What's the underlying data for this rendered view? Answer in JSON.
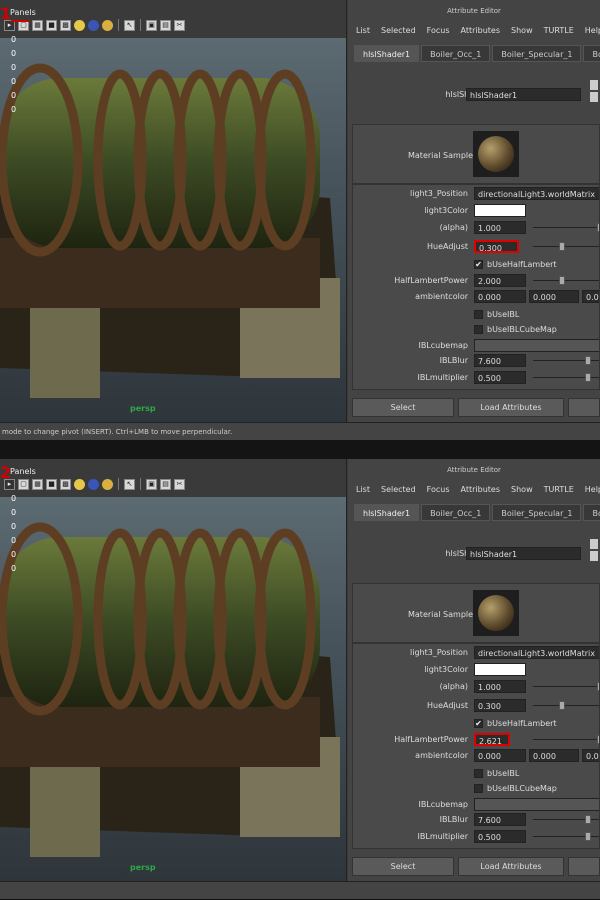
{
  "panels": [
    {
      "marker": "1",
      "viewport": {
        "menu": "Panels",
        "hud": [
          "0",
          "0",
          "0",
          "0",
          "0",
          "0"
        ],
        "camera": "persp"
      },
      "status": "mode to change pivot (INSERT).  Ctrl+LMB to move perpendicular.",
      "editor": {
        "title": "Attribute Editor",
        "menu": [
          "List",
          "Selected",
          "Focus",
          "Attributes",
          "Show",
          "TURTLE",
          "Help"
        ],
        "tabs": [
          "hlslShader1",
          "Boiler_Occ_1",
          "Boiler_Specular_1",
          "Boiler_Co"
        ],
        "shader_label": "hlslShader:",
        "shader_value": "hlslShader1",
        "material_sample": "Material Sample",
        "attrs": {
          "light3_position": {
            "label": "light3_Position",
            "value": "directionalLight3.worldMatrix"
          },
          "light3_color": {
            "label": "light3Color"
          },
          "alpha": {
            "label": "(alpha)",
            "value": "1.000"
          },
          "hue_adjust": {
            "label": "HueAdjust",
            "value": "0.300"
          },
          "b_use_half_lambert": {
            "label": "bUseHalfLambert",
            "checked": "✔"
          },
          "half_lambert_power": {
            "label": "HalfLambertPower",
            "value": "2.000"
          },
          "ambientcolor": {
            "label": "ambientcolor",
            "r": "0.000",
            "g": "0.000",
            "b": "0.000"
          },
          "b_use_ibl": {
            "label": "bUseIBL"
          },
          "b_use_ibl_cubemap": {
            "label": "bUseIBLCubeMap"
          },
          "ibl_cubemap": {
            "label": "IBLcubemap"
          },
          "ibl_blur": {
            "label": "IBLBlur",
            "value": "7.600"
          },
          "ibl_multiplier": {
            "label": "IBLmultiplier",
            "value": "0.500"
          }
        },
        "buttons": {
          "select": "Select",
          "load": "Load Attributes",
          "extra": ""
        }
      }
    },
    {
      "marker": "2",
      "viewport": {
        "menu": "Panels",
        "hud": [
          "0",
          "0",
          "0",
          "0",
          "0",
          "0"
        ],
        "camera": "persp"
      },
      "status": "",
      "editor": {
        "title": "Attribute Editor",
        "menu": [
          "List",
          "Selected",
          "Focus",
          "Attributes",
          "Show",
          "TURTLE",
          "Help"
        ],
        "tabs": [
          "hlslShader1",
          "Boiler_Occ_1",
          "Boiler_Specular_1",
          "Boiler_Co"
        ],
        "shader_label": "hlslShader:",
        "shader_value": "hlslShader1",
        "material_sample": "Material Sample",
        "attrs": {
          "light3_position": {
            "label": "light3_Position",
            "value": "directionalLight3.worldMatrix"
          },
          "light3_color": {
            "label": "light3Color"
          },
          "alpha": {
            "label": "(alpha)",
            "value": "1.000"
          },
          "hue_adjust": {
            "label": "HueAdjust",
            "value": "0.300"
          },
          "b_use_half_lambert": {
            "label": "bUseHalfLambert",
            "checked": "✔"
          },
          "half_lambert_power": {
            "label": "HalfLambertPower",
            "value": "2.621"
          },
          "ambientcolor": {
            "label": "ambientcolor",
            "r": "0.000",
            "g": "0.000",
            "b": "0.000"
          },
          "b_use_ibl": {
            "label": "bUseIBL"
          },
          "b_use_ibl_cubemap": {
            "label": "bUseIBLCubeMap"
          },
          "ibl_cubemap": {
            "label": "IBLcubemap"
          },
          "ibl_blur": {
            "label": "IBLBlur",
            "value": "7.600"
          },
          "ibl_multiplier": {
            "label": "IBLmultiplier",
            "value": "0.500"
          }
        },
        "buttons": {
          "select": "Select",
          "load": "Load Attributes",
          "extra": ""
        }
      }
    }
  ],
  "icons": [
    "camera-icon",
    "cube-icon",
    "sphere-icon",
    "light-icon",
    "select-icon",
    "frame-icon",
    "snap-icon"
  ],
  "colors": {
    "highlight": "#e00000",
    "camera_label": "#2fa84a"
  }
}
